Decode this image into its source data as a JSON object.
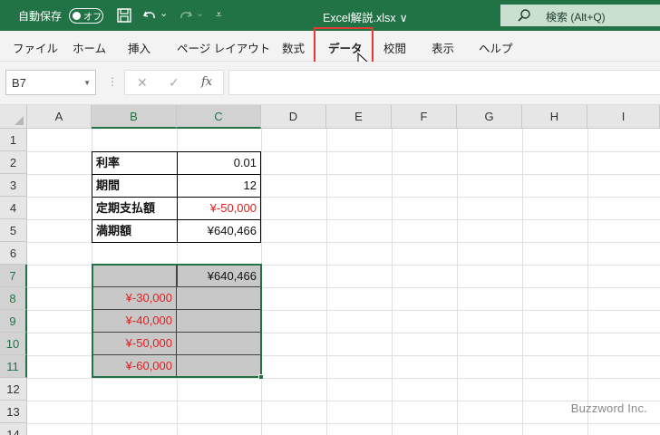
{
  "titlebar": {
    "autosave_label": "自動保存",
    "autosave_state": "オフ",
    "filename": "Excel解説.xlsx",
    "filename_chevron": "∨",
    "search_text": "検索 (Alt+Q)",
    "quick_access_more": "⩡",
    "undo_dropdown": "⌄",
    "redo_dropdown": "⌄"
  },
  "menu": {
    "items": [
      "ファイル",
      "ホーム",
      "挿入",
      "ページ レイアウト",
      "数式",
      "データ",
      "校閲",
      "表示",
      "ヘルプ"
    ],
    "highlighted": "データ"
  },
  "formula_bar": {
    "name_box": "B7",
    "cancel": "✕",
    "enter": "✓",
    "fx": "fx",
    "content": ""
  },
  "grid": {
    "columns": [
      "A",
      "B",
      "C",
      "D",
      "E",
      "F",
      "G",
      "H",
      "I"
    ],
    "rows": [
      "1",
      "2",
      "3",
      "4",
      "5",
      "6",
      "7",
      "8",
      "9",
      "10",
      "11",
      "12",
      "13",
      "14"
    ],
    "selected_columns": [
      "B",
      "C"
    ],
    "selected_rows": [
      "7",
      "8",
      "9",
      "10",
      "11"
    ]
  },
  "params_table": [
    {
      "label": "利率",
      "value": "0.01"
    },
    {
      "label": "期間",
      "value": "12"
    },
    {
      "label": "定期支払額",
      "value": "¥-50,000"
    },
    {
      "label": "満期額",
      "value": "¥640,466"
    }
  ],
  "data_table": {
    "header_value": "¥640,466",
    "inputs": [
      "¥-30,000",
      "¥-40,000",
      "¥-50,000",
      "¥-60,000"
    ]
  },
  "watermark": "Buzzword Inc.",
  "colors": {
    "excel_green": "#217346",
    "negative_red": "#e02020",
    "highlight_red": "#e53935"
  }
}
